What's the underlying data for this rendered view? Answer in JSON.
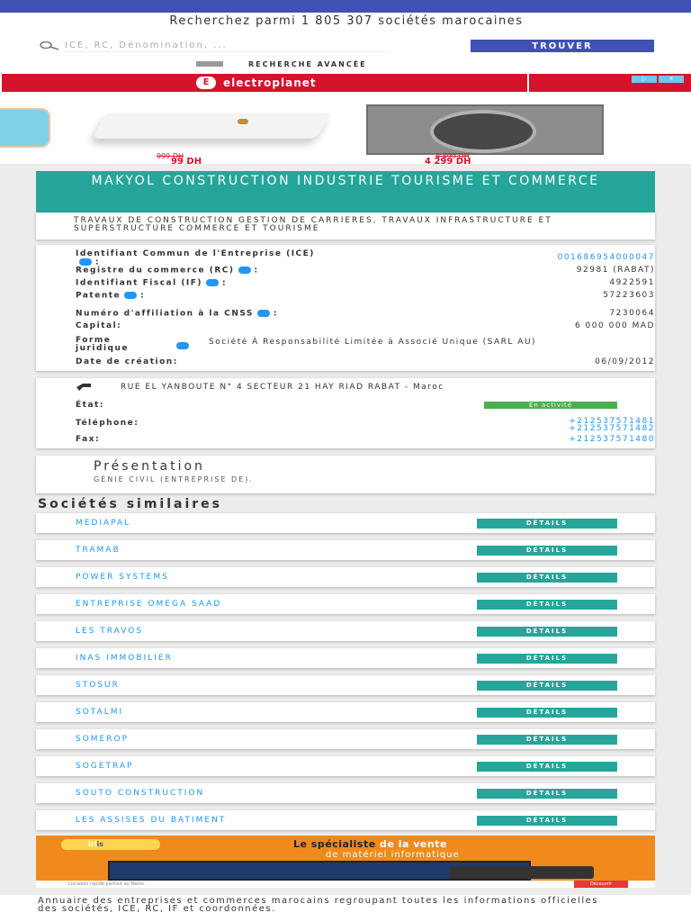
{
  "search": {
    "title": "Recherchez parmi 1 805 307 sociétés marocaines",
    "placeholder": "ICE, RC, Dénomination, ...",
    "button": "TROUVER",
    "advanced": "RECHERCHE AVANCÉE"
  },
  "ad_banner": {
    "brand_logo": "E",
    "brand": "electroplanet",
    "products": [
      {
        "old_price": "999 DH",
        "price": "99 DH"
      },
      {
        "old_price": "4 499 DH",
        "price": "4 299 DH"
      }
    ]
  },
  "company": {
    "name": "MAKYOL CONSTRUCTION INDUSTRIE TOURISME ET COMMERCE",
    "activity": "TRAVAUX DE CONSTRUCTION GESTION DE CARRIERES, TRAVAUX INFRASTRUCTURE ET SUPERSTRUCTURE COMMERCE ET TOURISME"
  },
  "identifiers": [
    {
      "label": "Identifiant Commun de l'Entreprise (ICE)",
      "value": "001686954000047",
      "link": true,
      "info": true
    },
    {
      "label": "Registre du commerce (RC)",
      "value": "92981 (RABAT)",
      "link": false,
      "info": true
    },
    {
      "label": "Identifiant Fiscal (IF)",
      "value": "4922591",
      "link": false,
      "info": true
    },
    {
      "label": "Patente",
      "value": "57223603",
      "link": false,
      "info": true
    },
    {
      "label": "Numéro d'affiliation à la CNSS",
      "value": "7230064",
      "link": false,
      "info": true
    },
    {
      "label": "Capital:",
      "value": "6 000 000 MAD",
      "link": false,
      "info": false
    },
    {
      "label": "Forme juridique",
      "value": "Société À Responsabilité Limitée à Associé Unique (SARL AU)",
      "link": false,
      "info": true
    },
    {
      "label": "Date de création:",
      "value": "06/09/2012",
      "link": false,
      "info": false
    }
  ],
  "contact": {
    "address": "RUE EL YANBOUTE N° 4 SECTEUR 21 HAY RIAD RABAT - Maroc",
    "status_label": "État:",
    "status": "En activité",
    "phone_label": "Téléphone:",
    "phones": [
      "+212537571481",
      "+212537571482"
    ],
    "fax_label": "Fax:",
    "fax": "+212537571480"
  },
  "presentation": {
    "title": "Présentation",
    "text": "GÉNIE CIVIL (ENTREPRISE DE)."
  },
  "similar": {
    "title": "Sociétés similaires",
    "button": "DÉTAILS",
    "items": [
      "MEDIAPAL",
      "TRAMAB",
      "POWER SYSTEMS",
      "ENTREPRISE OMEGA SAAD",
      "LES TRAVOS",
      "INAS IMMOBILIER",
      "STOSUR",
      "SOTALMI",
      "SOMEROP",
      "SOGETRAP",
      "SOUTO CONSTRUCTION",
      "LES ASSISES DU BATIMENT"
    ]
  },
  "ad2": {
    "logo_a": "iri",
    "logo_b": "is",
    "headline_a": "Le spécialiste",
    "headline_b": " de la vente",
    "subline": "de matériel informatique",
    "strip": "Livraison rapide partout au Maroc",
    "button": "Découvrir"
  },
  "footer": {
    "text": "Annuaire des entreprises et commerces marocains regroupant toutes les informations officielles des sociétés, ICE, RC, IF et coordonnées."
  }
}
